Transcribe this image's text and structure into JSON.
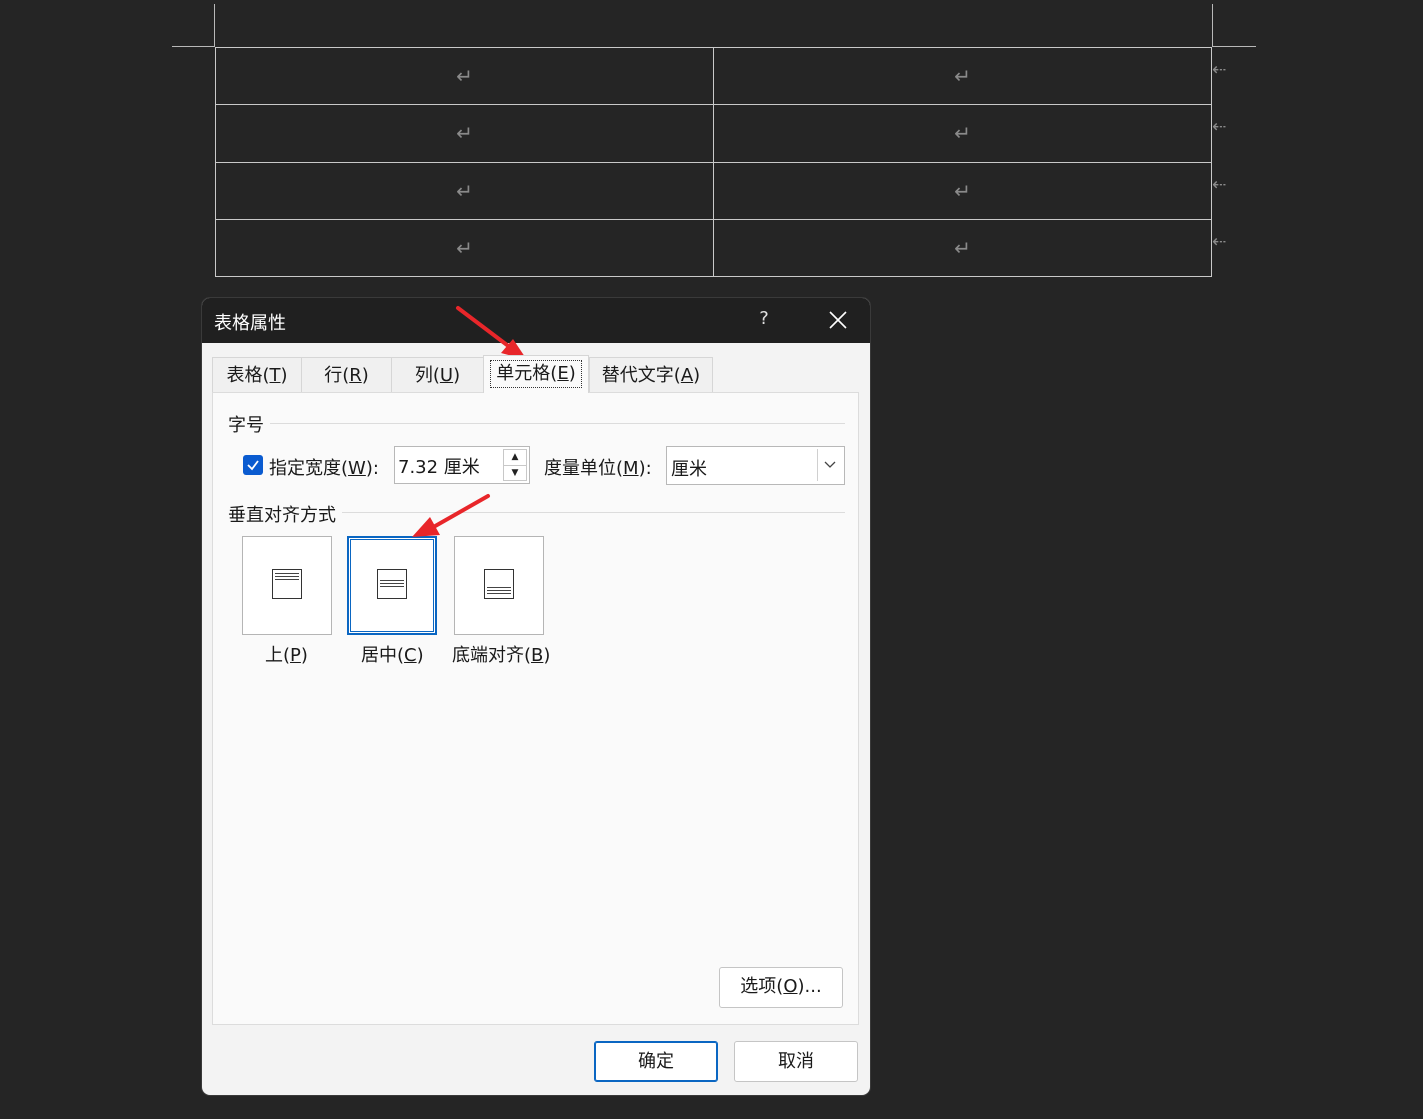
{
  "document": {
    "paragraph_mark": "↵",
    "row_end_mark": "⇠",
    "rows": [
      [
        "↵",
        "↵"
      ],
      [
        "↵",
        "↵"
      ],
      [
        "↵",
        "↵"
      ],
      [
        "↵",
        "↵"
      ]
    ]
  },
  "dialog": {
    "title": "表格属性",
    "help_label": "?",
    "close_label": "✕",
    "tabs": [
      {
        "label": "表格",
        "key": "T"
      },
      {
        "label": "行",
        "key": "R"
      },
      {
        "label": "列",
        "key": "U"
      },
      {
        "label": "单元格",
        "key": "E"
      },
      {
        "label": "替代文字",
        "key": "A"
      }
    ],
    "active_tab": "单元格",
    "size_section": {
      "title": "字号",
      "width_checkbox_label": "指定宽度",
      "width_checkbox_key": "W",
      "width_checked": true,
      "width_value": "7.32 厘米",
      "unit_label": "度量单位",
      "unit_key": "M",
      "unit_value": "厘米"
    },
    "valign_section": {
      "title": "垂直对齐方式",
      "options": [
        {
          "label": "上",
          "key": "P"
        },
        {
          "label": "居中",
          "key": "C"
        },
        {
          "label": "底端对齐",
          "key": "B"
        }
      ],
      "selected": "居中"
    },
    "options_button": {
      "label": "选项",
      "key": "O",
      "suffix": "..."
    },
    "ok_label": "确定",
    "cancel_label": "取消"
  },
  "colors": {
    "background": "#252525",
    "titlebar": "#202020",
    "accent": "#0a66c2",
    "annotation": "#e8262a"
  }
}
